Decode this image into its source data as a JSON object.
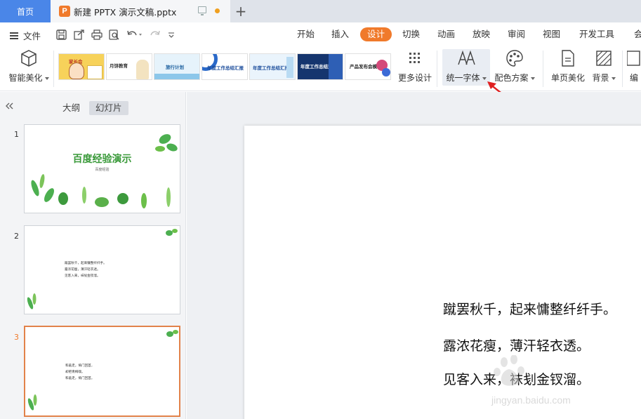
{
  "titlebar": {
    "home_tab": "首页",
    "doc_icon_letter": "P",
    "doc_title": "新建 PPTX 演示文稿.pptx",
    "new_tab": "+"
  },
  "menubar": {
    "file_label": "文件",
    "tabs": [
      "开始",
      "插入",
      "设计",
      "切换",
      "动画",
      "放映",
      "审阅",
      "视图",
      "开发工具",
      "会"
    ],
    "active_tab": "设计"
  },
  "ribbon": {
    "smart_beautify": "智能美化",
    "templates": [
      {
        "text": "家长会",
        "bg": "#f7d25a"
      },
      {
        "text": "月饼教育",
        "bg": "#ffffff"
      },
      {
        "text": "旅行计划",
        "bg": "#e6f3fb"
      },
      {
        "text": "年度工作总结汇报",
        "bg": "#ffffff"
      },
      {
        "text": "年度工作总结汇报",
        "bg": "#eaf4fc"
      },
      {
        "text": "年度工作总结汇报",
        "bg": "#15356e"
      },
      {
        "text": "产品发布会模板",
        "bg": "#ffffff"
      }
    ],
    "more_design": "更多设计",
    "unify_font": "统一字体",
    "color_scheme": "配色方案",
    "single_page_beautify": "单页美化",
    "background": "背景",
    "edit": "编"
  },
  "leftpanel": {
    "outline_tab": "大纲",
    "slides_tab": "幻灯片",
    "slides": [
      {
        "number": "1",
        "title": "百度经验演示",
        "subtitle": "百度经验"
      },
      {
        "number": "2",
        "lines": [
          "蹴罢秋千，起来慵整纤纤手。",
          "露浓花瘦，薄汗轻衣透。",
          "见客入来，袜刬金钗溜。"
        ]
      },
      {
        "number": "3",
        "lines": [
          "和羞走，倚门回首，",
          "却把青梅嗅。",
          "和羞走，倚门回首。"
        ]
      }
    ]
  },
  "slide": {
    "lines": [
      "蹴罢秋千，起来慵整纤纤手。",
      "露浓花瘦，薄汗轻衣透。",
      "见客入来，袜刬金钗溜。"
    ]
  },
  "watermark": {
    "text": "jingyan.baidu.com"
  },
  "colors": {
    "accent": "#f07a2b",
    "home_tab": "#4a86e8",
    "leaf_green": "#4caf50",
    "arrow_red": "#e02020"
  }
}
